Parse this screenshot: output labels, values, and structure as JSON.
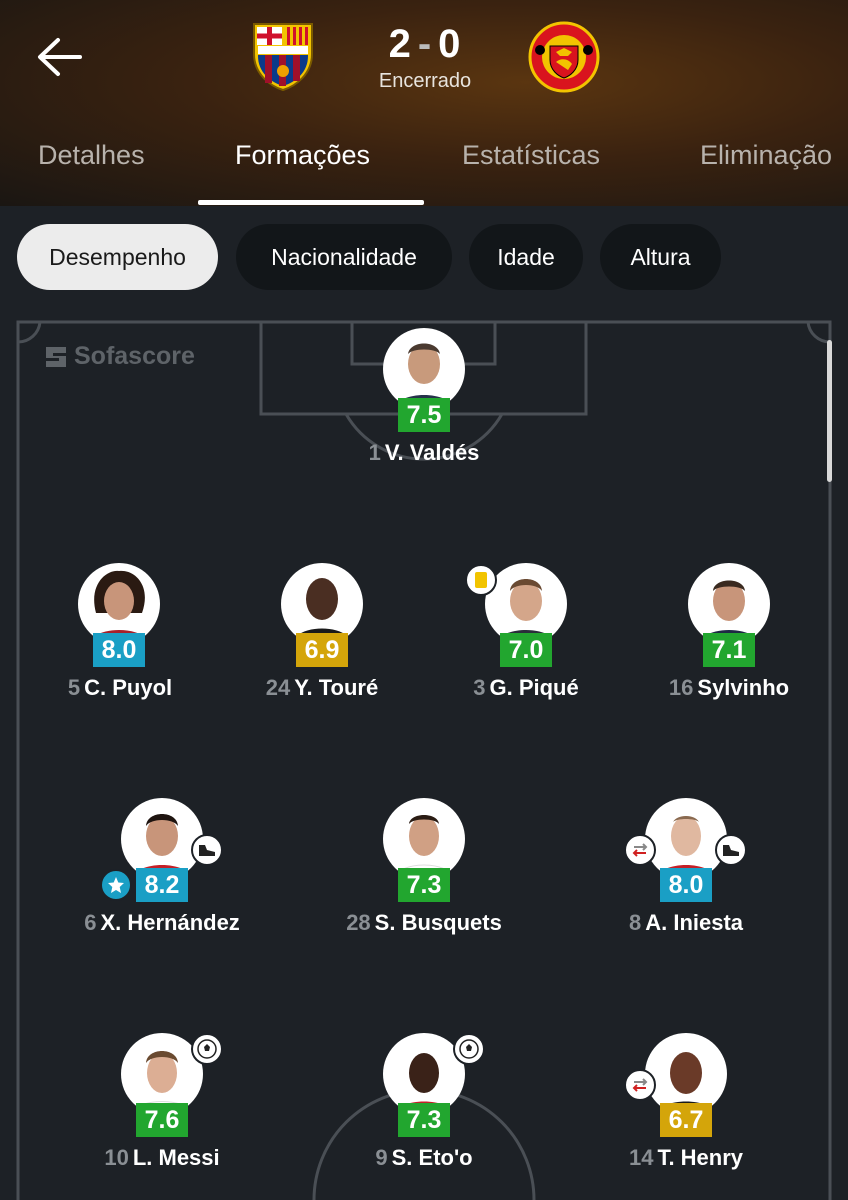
{
  "match": {
    "score_home": "2",
    "score_separator": "-",
    "score_away": "0",
    "status": "Encerrado",
    "home_team_icon": "fc-barcelona-crest-icon",
    "away_team_icon": "manchester-united-crest-icon"
  },
  "tabs": [
    {
      "label": "Detalhes",
      "active": false
    },
    {
      "label": "Formações",
      "active": true
    },
    {
      "label": "Estatísticas",
      "active": false
    },
    {
      "label": "Eliminação",
      "active": false
    }
  ],
  "filters": [
    {
      "label": "Desempenho",
      "active": true
    },
    {
      "label": "Nacionalidade",
      "active": false
    },
    {
      "label": "Idade",
      "active": false
    },
    {
      "label": "Altura",
      "active": false
    }
  ],
  "field": {
    "watermark": "Sofascore"
  },
  "players": [
    {
      "number": "1",
      "name": "V. Valdés",
      "rating": "7.5",
      "rating_color": "#22a62f"
    },
    {
      "number": "5",
      "name": "C. Puyol",
      "rating": "8.0",
      "rating_color": "#1a9fc5"
    },
    {
      "number": "24",
      "name": "Y. Touré",
      "rating": "6.9",
      "rating_color": "#d4a50a"
    },
    {
      "number": "3",
      "name": "G. Piqué",
      "rating": "7.0",
      "rating_color": "#22a62f",
      "event": "yellow-card-icon"
    },
    {
      "number": "16",
      "name": "Sylvinho",
      "rating": "7.1",
      "rating_color": "#22a62f"
    },
    {
      "number": "6",
      "name": "X. Hernández",
      "rating": "8.2",
      "rating_color": "#1a9fc5",
      "event": "boot-assist-icon",
      "extra": "man-of-the-match-star-icon"
    },
    {
      "number": "28",
      "name": "S. Busquets",
      "rating": "7.3",
      "rating_color": "#22a62f"
    },
    {
      "number": "8",
      "name": "A. Iniesta",
      "rating": "8.0",
      "rating_color": "#1a9fc5",
      "event": "boot-assist-icon",
      "extra": "substitution-icon"
    },
    {
      "number": "10",
      "name": "L. Messi",
      "rating": "7.6",
      "rating_color": "#22a62f",
      "event": "ball-goal-icon"
    },
    {
      "number": "9",
      "name": "S. Eto'o",
      "rating": "7.3",
      "rating_color": "#22a62f",
      "event": "ball-goal-icon"
    },
    {
      "number": "14",
      "name": "T. Henry",
      "rating": "6.7",
      "rating_color": "#d4a50a",
      "extra": "substitution-icon"
    }
  ]
}
